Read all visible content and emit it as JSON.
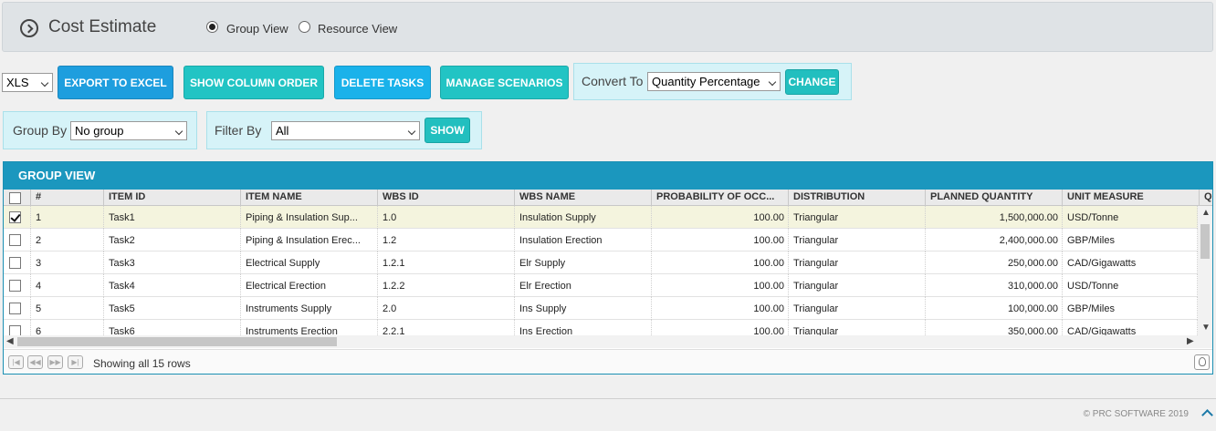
{
  "header": {
    "title": "Cost Estimate",
    "views": [
      {
        "label": "Group View",
        "selected": true
      },
      {
        "label": "Resource View",
        "selected": false
      }
    ]
  },
  "toolbar": {
    "format_value": "XLS",
    "export_label": "EXPORT TO EXCEL",
    "column_order_label": "SHOW COLUMN ORDER",
    "delete_label": "DELETE TASKS",
    "scenarios_label": "MANAGE SCENARIOS",
    "convert_label": "Convert To",
    "convert_value": "Quantity Percentage",
    "change_label": "CHANGE"
  },
  "filters": {
    "group_by_label": "Group By",
    "group_by_value": "No group",
    "filter_by_label": "Filter By",
    "filter_by_value": "All",
    "show_label": "SHOW"
  },
  "grid": {
    "title": "GROUP VIEW",
    "columns": [
      "#",
      "ITEM ID",
      "ITEM NAME",
      "WBS ID",
      "WBS NAME",
      "PROBABILITY OF OCC...",
      "DISTRIBUTION",
      "PLANNED QUANTITY",
      "UNIT MEASURE",
      "Q"
    ],
    "rows": [
      {
        "checked": true,
        "num": "1",
        "item_id": "Task1",
        "item_name": "Piping & Insulation Sup...",
        "wbs_id": "1.0",
        "wbs_name": "Insulation Supply",
        "prob": "100.00",
        "dist": "Triangular",
        "qty": "1,500,000.00",
        "unit": "USD/Tonne"
      },
      {
        "checked": false,
        "num": "2",
        "item_id": "Task2",
        "item_name": "Piping & Insulation Erec...",
        "wbs_id": "1.2",
        "wbs_name": "Insulation Erection",
        "prob": "100.00",
        "dist": "Triangular",
        "qty": "2,400,000.00",
        "unit": "GBP/Miles"
      },
      {
        "checked": false,
        "num": "3",
        "item_id": "Task3",
        "item_name": "Electrical Supply",
        "wbs_id": "1.2.1",
        "wbs_name": "Elr Supply",
        "prob": "100.00",
        "dist": "Triangular",
        "qty": "250,000.00",
        "unit": "CAD/Gigawatts"
      },
      {
        "checked": false,
        "num": "4",
        "item_id": "Task4",
        "item_name": "Electrical Erection",
        "wbs_id": "1.2.2",
        "wbs_name": "Elr Erection",
        "prob": "100.00",
        "dist": "Triangular",
        "qty": "310,000.00",
        "unit": "USD/Tonne"
      },
      {
        "checked": false,
        "num": "5",
        "item_id": "Task5",
        "item_name": "Instruments Supply",
        "wbs_id": "2.0",
        "wbs_name": "Ins Supply",
        "prob": "100.00",
        "dist": "Triangular",
        "qty": "100,000.00",
        "unit": "GBP/Miles"
      },
      {
        "checked": false,
        "num": "6",
        "item_id": "Task6",
        "item_name": "Instruments Erection",
        "wbs_id": "2.2.1",
        "wbs_name": "Ins Erection",
        "prob": "100.00",
        "dist": "Triangular",
        "qty": "350,000.00",
        "unit": "CAD/Gigawatts"
      }
    ],
    "pager_text": "Showing all 15 rows"
  },
  "footer": {
    "copyright": "© PRC SOFTWARE 2019"
  }
}
